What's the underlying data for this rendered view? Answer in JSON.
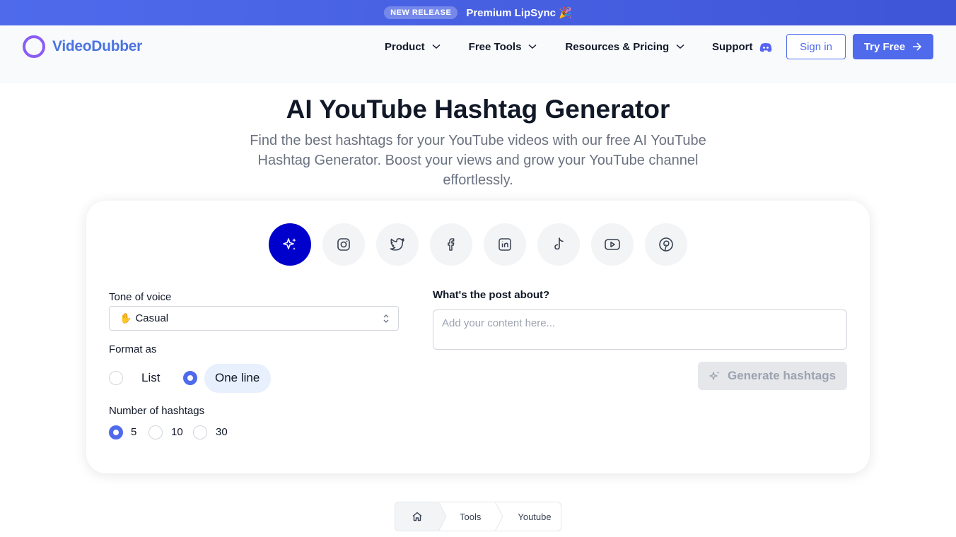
{
  "banner": {
    "badge": "NEW RELEASE",
    "text": "Premium LipSync 🎉"
  },
  "nav": {
    "logo": "VideoDubber",
    "items": [
      {
        "label": "Product"
      },
      {
        "label": "Free Tools"
      },
      {
        "label": "Resources & Pricing"
      }
    ],
    "support": "Support",
    "sign_in": "Sign in",
    "try_free": "Try Free"
  },
  "hero": {
    "title": "AI YouTube Hashtag Generator",
    "subtitle": "Find the best hashtags for your YouTube videos with our free AI YouTube Hashtag Generator. Boost your views and grow your YouTube channel effortlessly."
  },
  "platforms": [
    "sparkles-icon",
    "instagram-icon",
    "twitter-icon",
    "facebook-icon",
    "linkedin-icon",
    "tiktok-icon",
    "youtube-icon",
    "pinterest-icon"
  ],
  "form": {
    "tone_label": "Tone of voice",
    "tone_value": "Casual",
    "format_label": "Format as",
    "format_options": [
      "List",
      "One line"
    ],
    "format_selected": "One line",
    "count_label": "Number of hashtags",
    "count_options": [
      "5",
      "10",
      "30"
    ],
    "count_selected": "5",
    "post_label": "What's the post about?",
    "post_placeholder": "Add your content here...",
    "generate": "Generate hashtags"
  },
  "breadcrumb": [
    "Tools",
    "Youtube"
  ],
  "colors": {
    "accent": "#4f6bec",
    "active_platform": "#0000cc",
    "logo_ring": "#8b5cf6"
  }
}
